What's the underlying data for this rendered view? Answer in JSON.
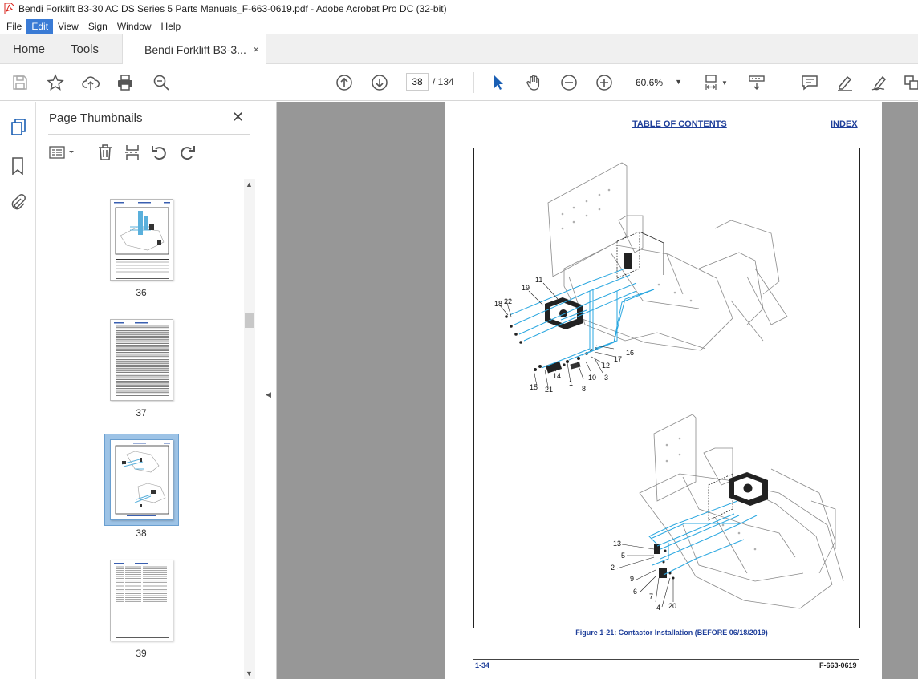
{
  "window": {
    "title": "Bendi Forklift B3-30 AC DS Series 5 Parts Manuals_F-663-0619.pdf - Adobe Acrobat Pro DC (32-bit)"
  },
  "menu": {
    "items": [
      "File",
      "Edit",
      "View",
      "Sign",
      "Window",
      "Help"
    ],
    "active": "Edit"
  },
  "tabs": {
    "home": "Home",
    "tools": "Tools",
    "doc": "Bendi Forklift B3-3...",
    "close_glyph": "×"
  },
  "toolbar": {
    "current_page": "38",
    "page_sep": "/  134",
    "zoom": "60.6%",
    "colors": {
      "icon": "#555555",
      "select_arrow": "#1a5fb4"
    }
  },
  "thumbnails": {
    "title": "Page Thumbnails",
    "close_glyph": "✕",
    "pages": [
      "36",
      "37",
      "38",
      "39"
    ],
    "selected": "38"
  },
  "document": {
    "header_toc": "TABLE OF CONTENTS",
    "header_index": "INDEX",
    "caption": "Figure 1-21:  Contactor Installation (BEFORE 06/18/2019)",
    "footer_left": "1-34",
    "footer_right": "F-663-0619",
    "callouts_top": [
      "22",
      "19",
      "11",
      "18",
      "16",
      "17",
      "12",
      "3",
      "10",
      "14",
      "1",
      "8",
      "15",
      "21"
    ],
    "callouts_bottom": [
      "13",
      "5",
      "2",
      "9",
      "6",
      "7",
      "4",
      "20"
    ],
    "link_color": "#1f3f9a",
    "leader_color": "#2aa7e0"
  }
}
